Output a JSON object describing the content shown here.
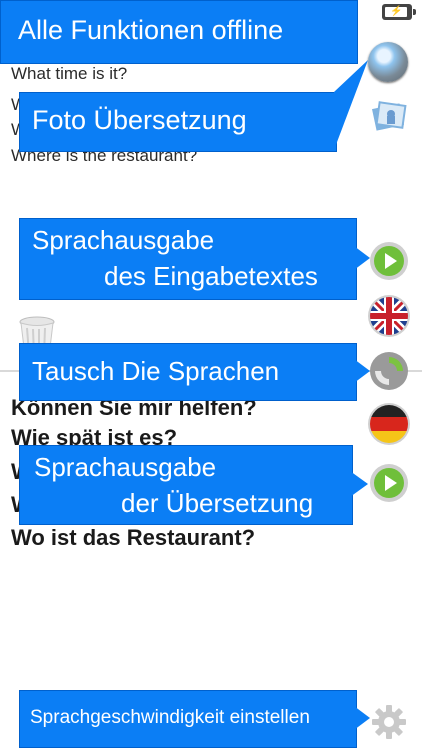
{
  "source_lines": [
    "What time is it?",
    "W",
    "W",
    "Where is the restaurant?"
  ],
  "target_lines": [
    "Können Sie mir helfen?",
    "Wie spät ist es?",
    "W",
    "W",
    "Wo ist das Restaurant?"
  ],
  "callouts": {
    "offline": "Alle Funktionen offline",
    "photo": "Foto Übersetzung",
    "speak_input_1": "Sprachausgabe",
    "speak_input_2": "des Eingabetextes",
    "swap": "Tausch Die Sprachen",
    "speak_output_1": "Sprachausgabe",
    "speak_output_2": "der Übersetzung",
    "speed": "Sprachgeschwindigkeit einstellen"
  },
  "icons": {
    "battery": "battery-charging-icon",
    "camera": "camera-icon",
    "photo": "photo-icon",
    "play_input": "play-icon",
    "flag_source": "uk-flag-icon",
    "swap": "swap-icon",
    "flag_target": "german-flag-icon",
    "play_output": "play-icon",
    "settings": "gear-icon",
    "trash": "trash-icon"
  },
  "colors": {
    "callout": "#0b7ef5",
    "play": "#6fbf3a"
  }
}
